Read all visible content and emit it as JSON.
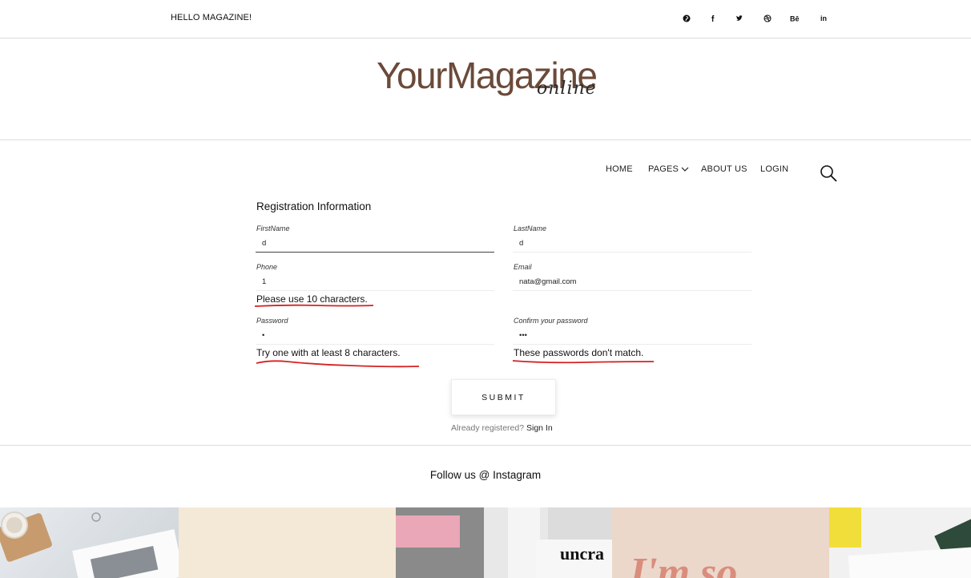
{
  "topbar": {
    "greeting": "HELLO MAGAZINE!",
    "social": [
      {
        "name": "pinterest",
        "glyph": "℗"
      },
      {
        "name": "facebook",
        "glyph": "f"
      },
      {
        "name": "twitter",
        "glyph": "✔"
      },
      {
        "name": "dribbble",
        "glyph": "⊛"
      },
      {
        "name": "behance",
        "glyph": "Bē"
      },
      {
        "name": "linkedin",
        "glyph": "in"
      }
    ]
  },
  "logo": {
    "main": "YourMagazine",
    "sub": "online",
    "color": "#6b4a3a"
  },
  "nav": {
    "home": "HOME",
    "pages": "PAGES",
    "about": "ABOUT US",
    "login": "LOGIN"
  },
  "form": {
    "title": "Registration Information",
    "first_name": {
      "label": "FirstName",
      "value": "d"
    },
    "last_name": {
      "label": "LastName",
      "value": "d"
    },
    "phone": {
      "label": "Phone",
      "value": "1",
      "error": "Please use 10 characters."
    },
    "email": {
      "label": "Email",
      "value": "nata@gmail.com"
    },
    "password": {
      "label": "Password",
      "value": "•",
      "error": "Try one with at least 8 characters."
    },
    "confirm": {
      "label": "Confirm your password",
      "value": "•••",
      "error": "These passwords don't match."
    },
    "submit": "SUBMIT",
    "already": "Already registered?",
    "sign_in": "Sign In",
    "error_underline_color": "#d62222"
  },
  "footer": {
    "follow": "Follow us @ Instagram"
  },
  "instagram": {
    "tiles": [
      {
        "text": ""
      },
      {
        "text": ""
      },
      {
        "text": "uncra"
      },
      {
        "text": "I'm so"
      },
      {
        "text": ""
      }
    ]
  }
}
